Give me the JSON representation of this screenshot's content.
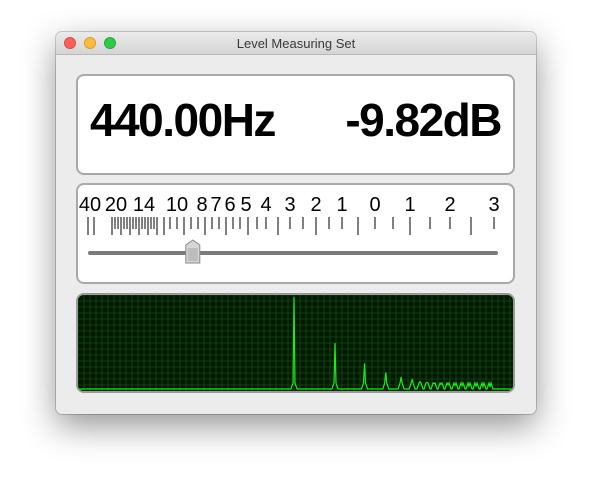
{
  "window": {
    "title": "Level Measuring Set"
  },
  "readout": {
    "frequency": "440.00Hz",
    "level": "-9.82dB"
  },
  "meter": {
    "scale_labels": [
      "40",
      "20",
      "14",
      "10",
      "8",
      "7",
      "6",
      "5",
      "4",
      "3",
      "2",
      "1",
      "0",
      "1",
      "2",
      "3"
    ],
    "slider_value": 0.28
  },
  "spectrum": {
    "colors": {
      "background": "#001a00",
      "grid": "#1f5a1f",
      "trace": "#1ee81e"
    },
    "peak_heights": [
      1.0,
      0.5,
      0.28,
      0.18,
      0.13,
      0.1,
      0.08,
      0.07,
      0.06,
      0.05,
      0.045,
      0.04,
      0.035,
      0.03,
      0.03,
      0.025,
      0.02
    ]
  }
}
